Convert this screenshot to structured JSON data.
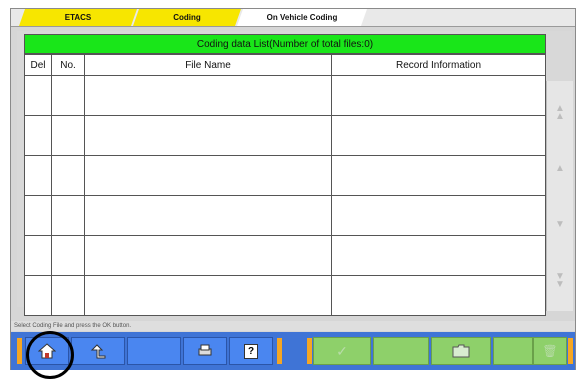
{
  "breadcrumb": [
    "ETACS",
    "Coding",
    "On Vehicle Coding"
  ],
  "list": {
    "title": "Coding data List(Number of total files:0)",
    "columns": [
      "Del",
      "No.",
      "File Name",
      "Record Information"
    ],
    "rows": 6
  },
  "status_text": "Select Coding File and press the OK button.",
  "toolbar": {
    "home": "home-icon",
    "back": "back-arrow-icon",
    "print": "printer-icon",
    "help": "?",
    "ok": "check-icon",
    "folder": "folder-icon",
    "delete": "delete-icon"
  }
}
